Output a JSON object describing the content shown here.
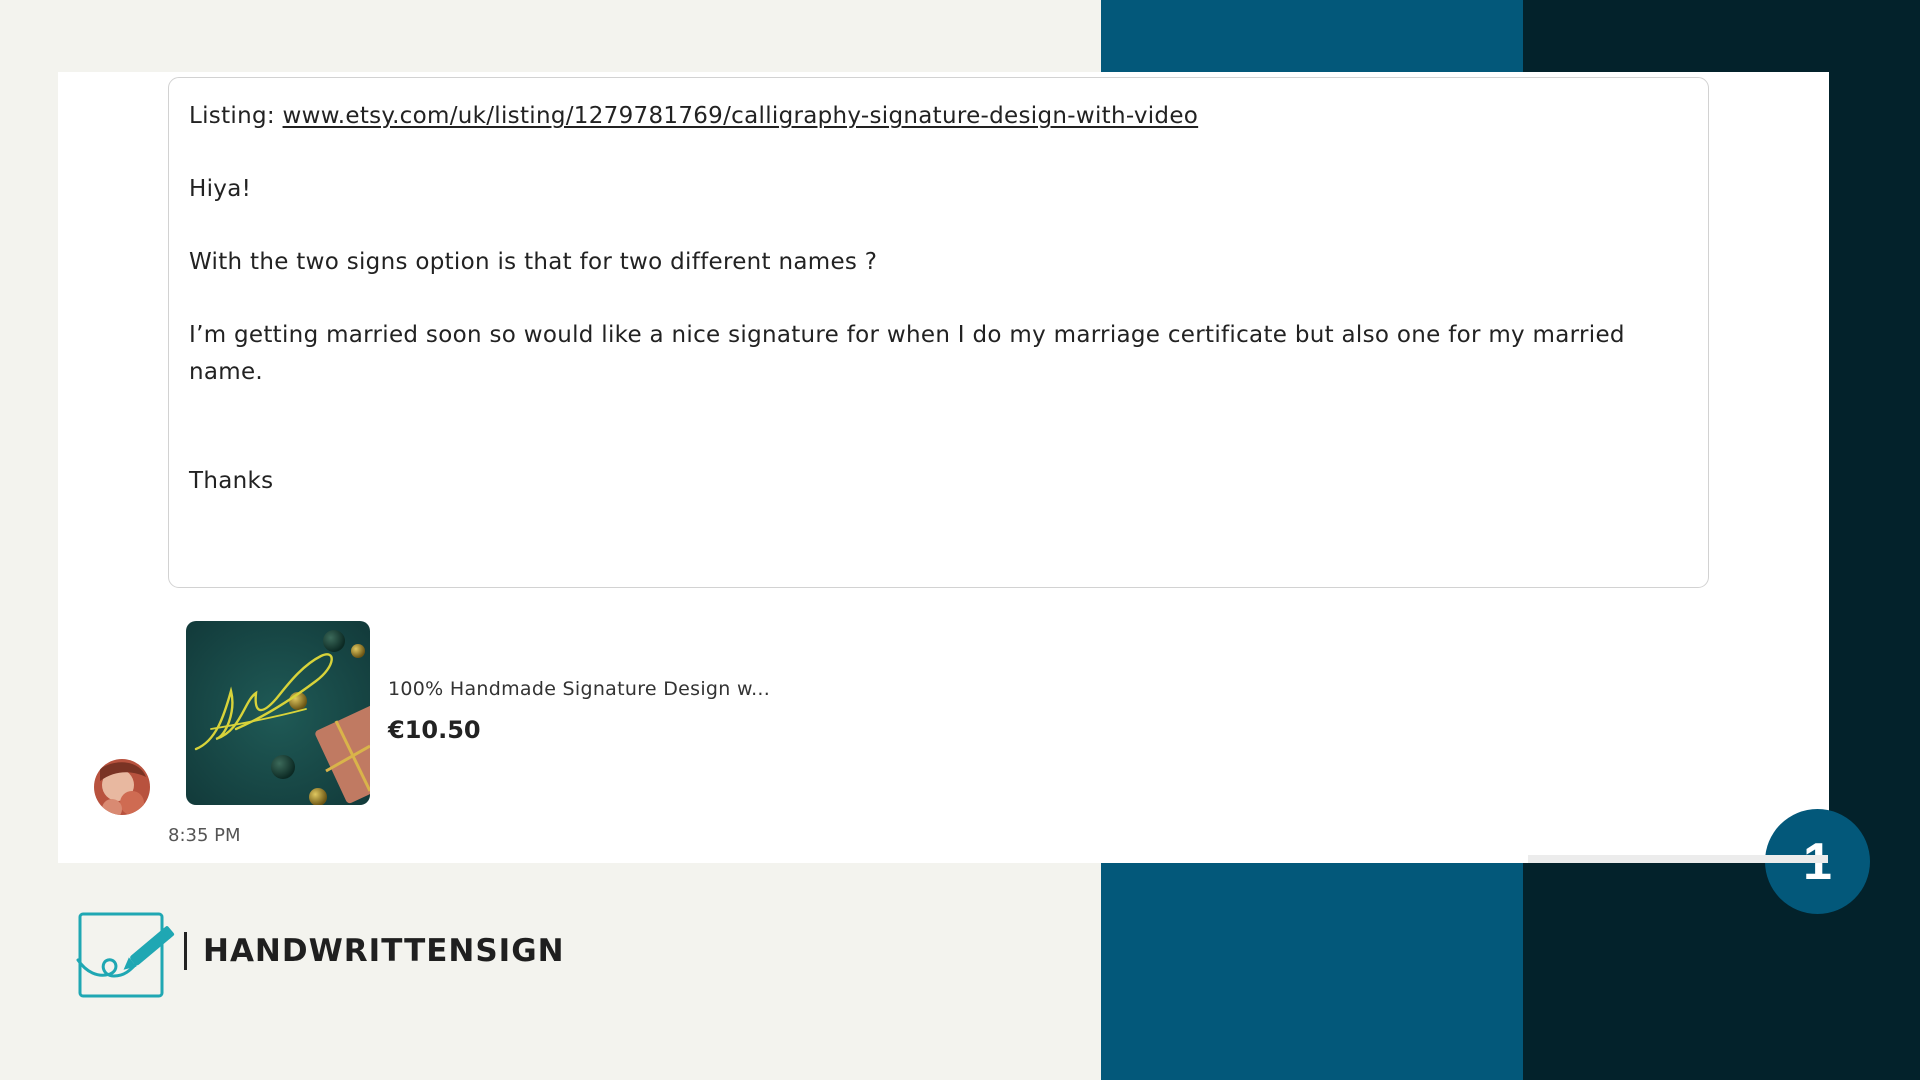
{
  "message": {
    "listing_label": "Listing: ",
    "listing_url": "www.etsy.com/uk/listing/1279781769/calligraphy-signature-design-with-video",
    "greeting": "Hiya!",
    "question": "With the two signs option is that for two different names ?",
    "body": "I’m getting married soon so would like a nice signature for when I do my marriage certificate but also one for my married name.",
    "signoff": "Thanks"
  },
  "listing_card": {
    "title": "100% Handmade Signature Design w...",
    "price": "€10.50"
  },
  "timestamp": "8:35 PM",
  "step_badge": "1",
  "brand": {
    "name": "HANDWRITTENSIGN",
    "accent_color": "#1fa7b3"
  },
  "colors": {
    "teal": "#03587a",
    "navy": "#03222b",
    "background": "#f3f3ee"
  },
  "icons": {
    "brand": "pen-signature-logo-icon"
  }
}
